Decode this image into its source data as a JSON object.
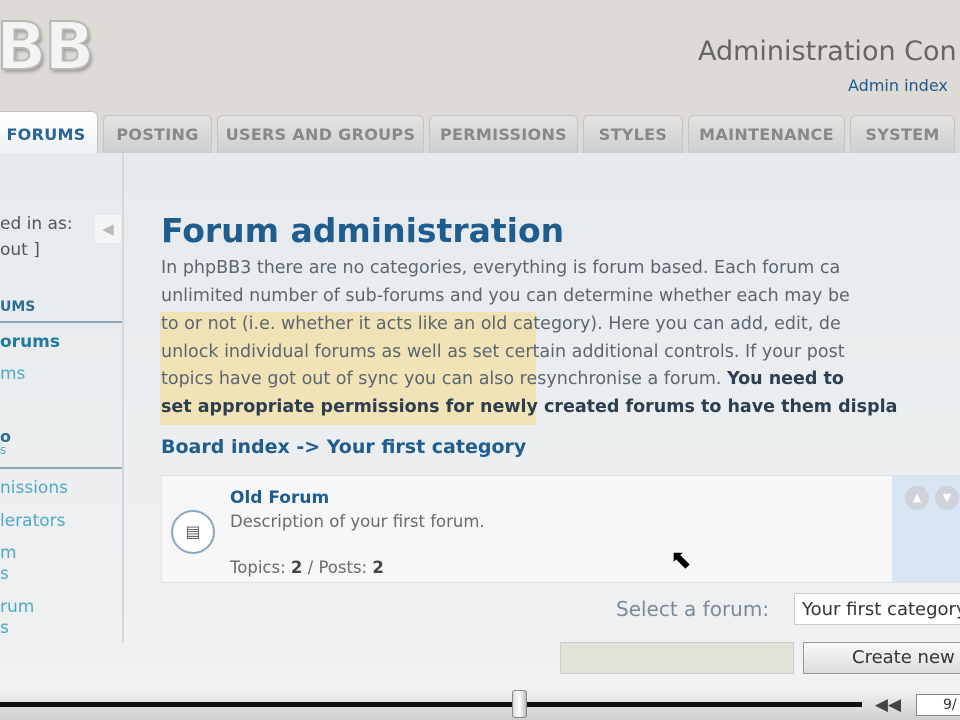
{
  "header": {
    "logo": "BB",
    "title": "Administration Con",
    "admin_index": "Admin index"
  },
  "tabs": [
    {
      "label": "FORUMS"
    },
    {
      "label": "POSTING"
    },
    {
      "label": "USERS AND GROUPS"
    },
    {
      "label": "PERMISSIONS"
    },
    {
      "label": "STYLES"
    },
    {
      "label": "MAINTENANCE"
    },
    {
      "label": "SYSTEM"
    }
  ],
  "sidebar": {
    "logged_in": "ed in as:",
    "logout": "out ]",
    "collapse": "◀",
    "section1": "UMS",
    "item1": "orums",
    "item2": "ms",
    "section2": "o",
    "section2b": "s",
    "item3": "nissions",
    "item4": "lerators",
    "item5a": "m",
    "item5b": "s",
    "item6a": "rum",
    "item6b": "s"
  },
  "main": {
    "title": "Forum administration",
    "lines": [
      "In phpBB3 there are no categories, everything is forum based. Each forum ca",
      "unlimited number of sub-forums and you can determine whether each may be",
      "to or not (i.e. whether it acts like an old category). Here you can add, edit, de",
      "unlock individual forums as well as set certain additional controls. If your post",
      "topics have got out of sync you can also resynchronise a forum. "
    ],
    "bold_a": "You need to",
    "bold_b": "set appropriate permissions for newly created forums to have them displa",
    "breadcrumb": "Board index -> Your first category",
    "forum": {
      "name": "Old Forum",
      "description": "Description of your first forum.",
      "topics_label": "Topics: ",
      "topics": "2",
      "posts_label": " / Posts: ",
      "posts": "2"
    },
    "select_label": "Select a forum:",
    "select_value": "Your first category",
    "create_button": "Create new forum"
  },
  "player": {
    "rewind": "◀◀",
    "time": "9/"
  }
}
